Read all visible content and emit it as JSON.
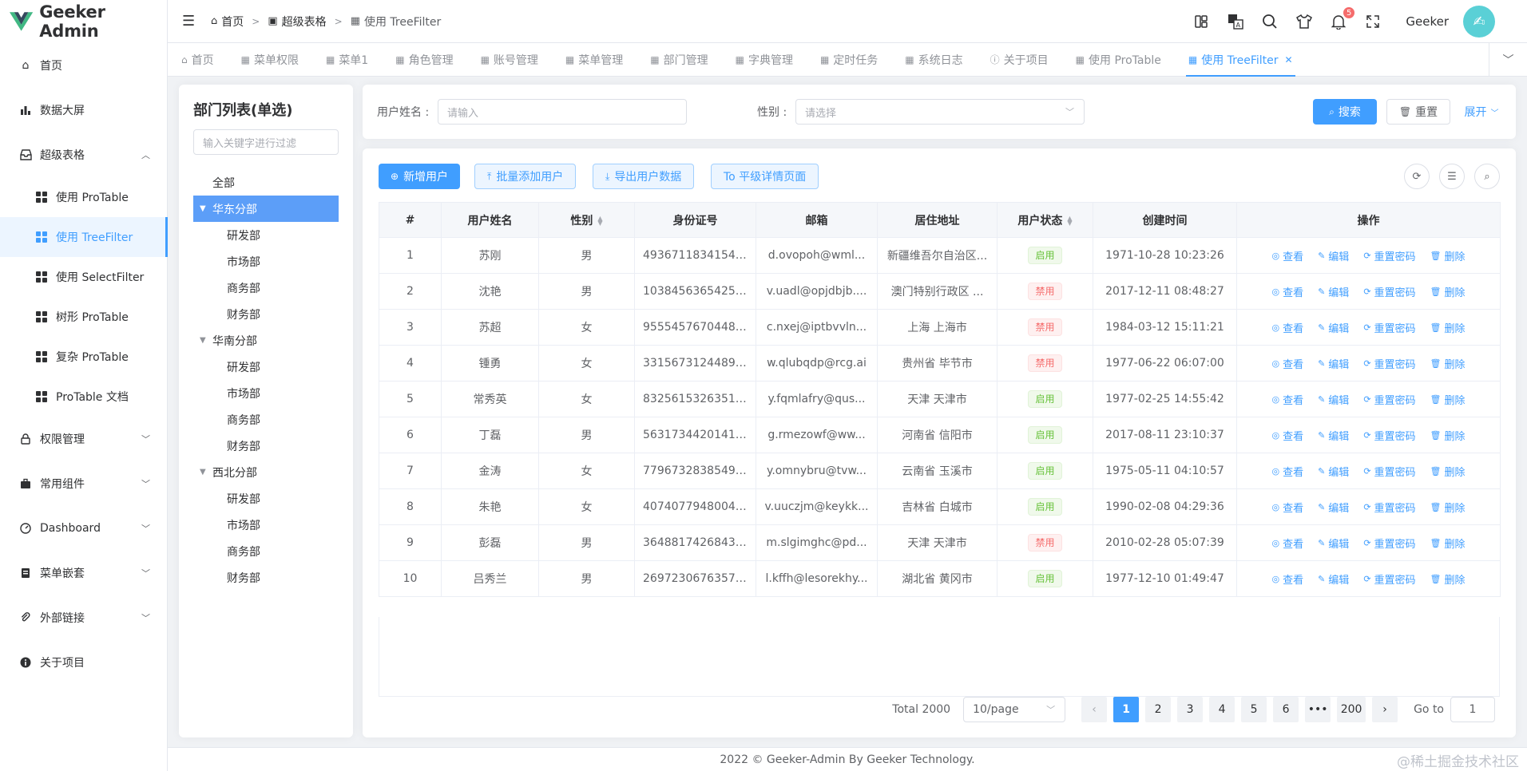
{
  "app": {
    "title": "Geeker Admin"
  },
  "sidebar": {
    "items": [
      {
        "label": "首页"
      },
      {
        "label": "数据大屏"
      },
      {
        "label": "超级表格"
      },
      {
        "label": "使用 ProTable"
      },
      {
        "label": "使用 TreeFilter"
      },
      {
        "label": "使用 SelectFilter"
      },
      {
        "label": "树形 ProTable"
      },
      {
        "label": "复杂 ProTable"
      },
      {
        "label": "ProTable 文档"
      },
      {
        "label": "权限管理"
      },
      {
        "label": "常用组件"
      },
      {
        "label": "Dashboard"
      },
      {
        "label": "菜单嵌套"
      },
      {
        "label": "外部链接"
      },
      {
        "label": "关于项目"
      }
    ]
  },
  "header": {
    "breadcrumb": [
      "首页",
      "超级表格",
      "使用 TreeFilter"
    ],
    "notification_count": "5",
    "username": "Geeker"
  },
  "tabs": [
    "首页",
    "菜单权限",
    "菜单1",
    "角色管理",
    "账号管理",
    "菜单管理",
    "部门管理",
    "字典管理",
    "定时任务",
    "系统日志",
    "关于项目",
    "使用 ProTable",
    "使用 TreeFilter"
  ],
  "tree": {
    "title": "部门列表(单选)",
    "filter_placeholder": "输入关键字进行过滤",
    "nodes": [
      "全部",
      "华东分部",
      "研发部",
      "市场部",
      "商务部",
      "财务部",
      "华南分部",
      "研发部",
      "市场部",
      "商务部",
      "财务部",
      "西北分部",
      "研发部",
      "市场部",
      "商务部",
      "财务部"
    ]
  },
  "search": {
    "username_label": "用户姓名 :",
    "username_placeholder": "请输入",
    "gender_label": "性别 :",
    "gender_placeholder": "请选择",
    "search_button": "搜索",
    "reset_button": "重置",
    "expand_button": "展开"
  },
  "toolbar": {
    "add_user": "新增用户",
    "batch_add": "批量添加用户",
    "export": "导出用户数据",
    "detail_page": "To 平级详情页面"
  },
  "table": {
    "columns": [
      "#",
      "用户姓名",
      "性别",
      "身份证号",
      "邮箱",
      "居住地址",
      "用户状态",
      "创建时间",
      "操作"
    ],
    "rows": [
      [
        "1",
        "苏刚",
        "男",
        "49367118341546...",
        "d.ovopoh@wml...",
        "新疆维吾尔自治区...",
        "启用",
        "1971-10-28 10:23:26"
      ],
      [
        "2",
        "沈艳",
        "男",
        "10384563654252...",
        "v.uadl@opjdbjb....",
        "澳门特别行政区 ...",
        "禁用",
        "2017-12-11 08:48:27"
      ],
      [
        "3",
        "苏超",
        "女",
        "95554576704489...",
        "c.nxej@iptbvvln...",
        "上海 上海市",
        "禁用",
        "1984-03-12 15:11:21"
      ],
      [
        "4",
        "锺勇",
        "女",
        "33156731244897...",
        "w.qlubqdp@rcg.ai",
        "贵州省 毕节市",
        "禁用",
        "1977-06-22 06:07:00"
      ],
      [
        "5",
        "常秀英",
        "女",
        "83256153263518...",
        "y.fqmlafry@qus...",
        "天津 天津市",
        "启用",
        "1977-02-25 14:55:42"
      ],
      [
        "6",
        "丁磊",
        "男",
        "56317344201417...",
        "g.rmezowf@ww...",
        "河南省 信阳市",
        "启用",
        "2017-08-11 23:10:37"
      ],
      [
        "7",
        "金涛",
        "女",
        "77967328385499...",
        "y.omnybru@tvw...",
        "云南省 玉溪市",
        "启用",
        "1975-05-11 04:10:57"
      ],
      [
        "8",
        "朱艳",
        "女",
        "40740779480044...",
        "v.uuczjm@keykk...",
        "吉林省 白城市",
        "启用",
        "1990-02-08 04:29:36"
      ],
      [
        "9",
        "彭磊",
        "男",
        "36488174268432...",
        "m.slgimghc@pd...",
        "天津 天津市",
        "禁用",
        "2010-02-28 05:07:39"
      ],
      [
        "10",
        "吕秀兰",
        "男",
        "26972306763572...",
        "l.kffh@lesorekhy...",
        "湖北省 黄冈市",
        "启用",
        "1977-12-10 01:49:47"
      ]
    ],
    "actions": [
      "查看",
      "编辑",
      "重置密码",
      "删除"
    ]
  },
  "pagination": {
    "total": "Total 2000",
    "page_size": "10/page",
    "pages": [
      "1",
      "2",
      "3",
      "4",
      "5",
      "6",
      "•••",
      "200"
    ],
    "goto_label": "Go to",
    "goto_value": "1"
  },
  "footer": {
    "text": "2022 © Geeker-Admin By Geeker Technology."
  },
  "watermark": "@稀土掘金技术社区",
  "colors": {
    "primary": "#409eff",
    "success": "#67c23a",
    "danger": "#f56c6c",
    "active_bg": "#ecf5ff"
  }
}
